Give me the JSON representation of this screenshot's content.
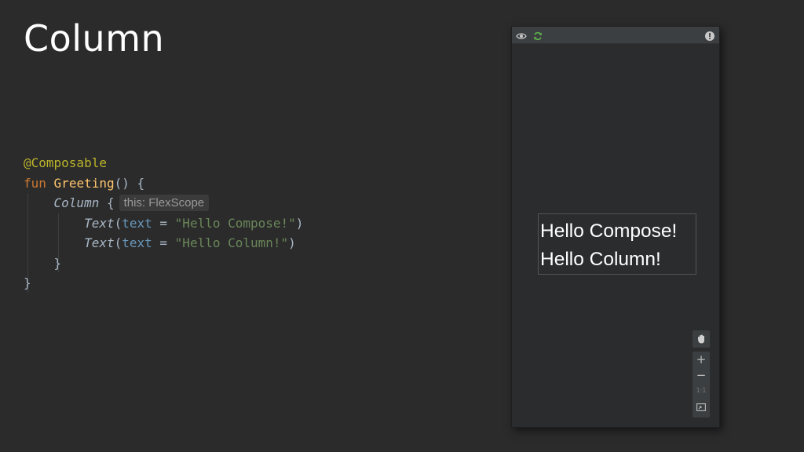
{
  "slide": {
    "title": "Column"
  },
  "code": {
    "annotation": "@Composable",
    "fun_keyword": "fun",
    "fun_name": "Greeting",
    "fun_sig": "() {",
    "column_call": "Column",
    "column_brace": " {",
    "hint": "this: FlexScope",
    "text_call": "Text",
    "paren_open": "(",
    "param_name": "text",
    "equals": " = ",
    "string_1": "\"Hello Compose!\"",
    "string_2": "\"Hello Column!\"",
    "paren_close": ")",
    "close_brace": "}"
  },
  "preview": {
    "icons": {
      "left_1": "eye-icon",
      "left_2": "refresh-icon",
      "right": "info-icon"
    },
    "rendered_lines": [
      "Hello Compose!",
      "Hello Column!"
    ],
    "tools": {
      "pan": "hand-icon",
      "zoom_in": "+",
      "zoom_out": "−",
      "actual_size": "1:1",
      "fit": "fit-screen-icon"
    }
  },
  "colors": {
    "background": "#2b2b2b",
    "annotation": "#bbb529",
    "keyword": "#cc7832",
    "function": "#ffc66d",
    "parameter": "#6897bb",
    "string": "#6a8759",
    "refresh_icon": "#5fb14a"
  }
}
